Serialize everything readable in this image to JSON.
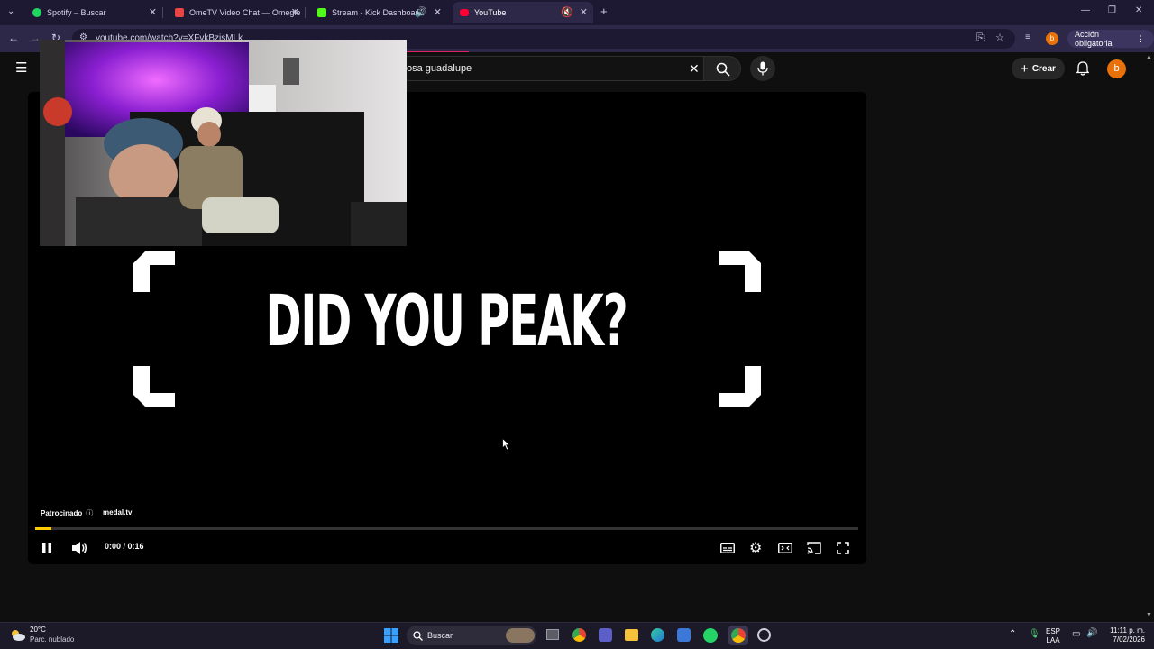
{
  "browser": {
    "tabs": [
      {
        "title": "Spotify – Buscar",
        "favicon_color": "#1ed760",
        "active": false
      },
      {
        "title": "OmeTV Video Chat — Omegle",
        "favicon_color": "#e94444",
        "active": false
      },
      {
        "title": "Stream - Kick Dashboard",
        "favicon_color": "#53fc18",
        "active": false,
        "audio": true
      },
      {
        "title": "YouTube",
        "favicon_color": "#ff0033",
        "active": true,
        "muted": true
      }
    ],
    "new_tab_label": "+",
    "window_controls": [
      "—",
      "❐",
      "✕"
    ],
    "url": "youtube.com/watch?v=XFvkBzisMLk",
    "profile_letter": "b",
    "action_button": "Acción obligatoria"
  },
  "youtube": {
    "search_query": "osa guadalupe",
    "create_label": "Crear",
    "avatar_letter": "b"
  },
  "player": {
    "headline": "DID YOU PEAK?",
    "sponsor_label": "Patrocinado",
    "sponsor_site": "medal.tv",
    "current_time": "0:00",
    "duration": "0:16",
    "time_display": "0:00 / 0:16",
    "progress_fraction": 0.02,
    "accent_color": "#ffcc00"
  },
  "taskbar": {
    "weather_temp": "20°C",
    "weather_desc": "Parc. nublado",
    "search_label": "Buscar",
    "language_top": "ESP",
    "language_bottom": "LAA",
    "time": "11:11 p. m.",
    "date": "7/02/2026"
  }
}
